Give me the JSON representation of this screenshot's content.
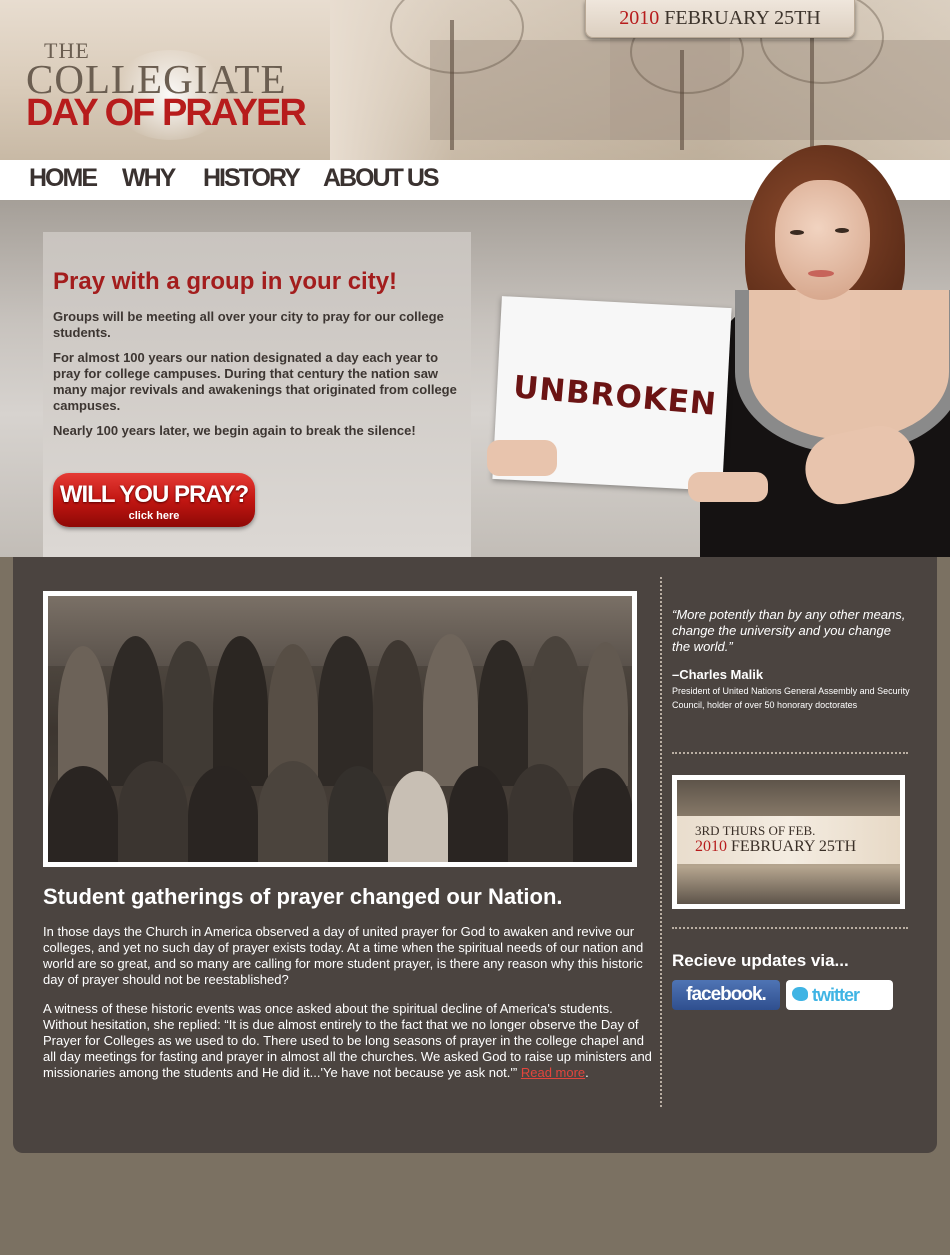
{
  "header": {
    "logo_the": "THE",
    "logo_collegiate": "COLLEGIATE",
    "logo_day_of_prayer": "DAY OF PRAYER",
    "date_year": "2010",
    "date_rest": "FEBRUARY 25TH"
  },
  "nav": {
    "items": [
      "HOME",
      "WHY",
      "HISTORY",
      "ABOUT US"
    ]
  },
  "hero": {
    "title": "Pray with a group in your city!",
    "paragraphs": [
      "Groups will be meeting all over your city to pray for our college students.",
      "For almost 100 years our nation designated a day each year to pray for college campuses. During that century the nation saw many major revivals and awakenings that originated from college campuses.",
      "Nearly 100 years later, we begin again to break the silence!"
    ],
    "button_main": "WILL YOU PRAY?",
    "button_sub": "click here",
    "sign_text": "UNBROKEN"
  },
  "main": {
    "section_title": "Student gatherings of prayer changed our Nation.",
    "paragraph1": "In those days the Church in America observed a day of united prayer for God to awaken and revive our colleges, and yet no such day of prayer exists today. At a time when the spiritual needs of our nation and world are so great, and so many are calling for more student prayer, is there any reason why this historic day of prayer should not be reestablished?",
    "paragraph2": "A witness of these historic events was once asked about the spiritual decline of America's students. Without hesitation, she replied: “It is due almost entirely to the fact that we no longer observe the Day of Prayer for Colleges as we used to do. There used to be long seasons of prayer in the college chapel and all day meetings for fasting and prayer in almost all the churches. We asked God to raise up ministers and missionaries among the students and He did it...'Ye have not because ye ask not.'”",
    "read_more": "Read more",
    "read_more_suffix": "."
  },
  "sidebar": {
    "quote": "“More potently than by any other means, change the university and you change the world.”",
    "author": "–Charles Malik",
    "author_role": "President of United Nations General Assembly and Security Council, holder of over 50 honorary doctorates",
    "banner_line1": "3RD THURS OF FEB.",
    "banner_year": "2010",
    "banner_date": "FEBRUARY 25TH",
    "updates_title": "Recieve updates via...",
    "facebook_label": "facebook.",
    "twitter_label": "twitter"
  },
  "colors": {
    "brand_red": "#b71c1c",
    "content_bg": "#4b4440",
    "page_bg": "#7b7162"
  }
}
